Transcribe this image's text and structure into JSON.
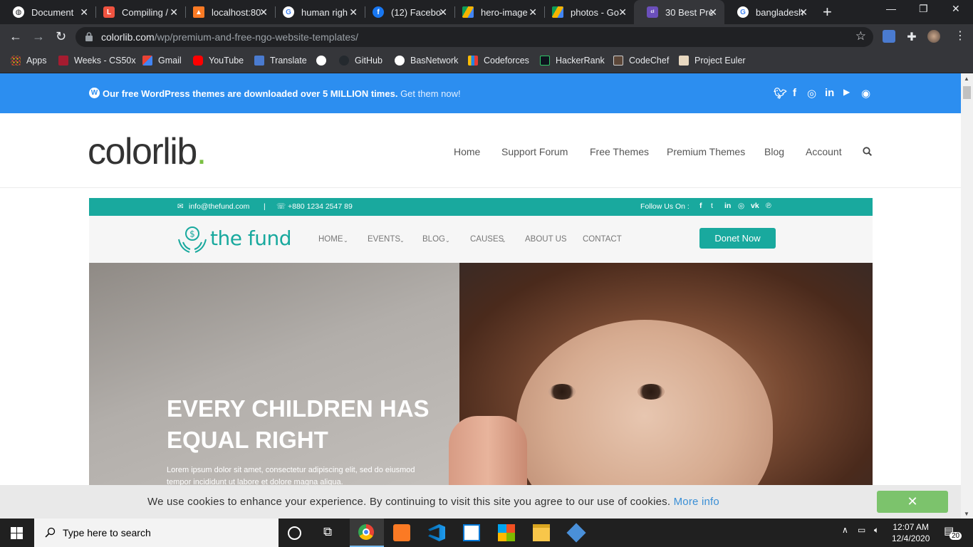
{
  "browser": {
    "tabs": [
      {
        "label": "Document",
        "favicon": "globe-icon"
      },
      {
        "label": "Compiling /",
        "favicon": "laravel-icon"
      },
      {
        "label": "localhost:80",
        "favicon": "xampp-icon"
      },
      {
        "label": "human righ",
        "favicon": "google-icon"
      },
      {
        "label": "(12) Facebo",
        "favicon": "facebook-icon"
      },
      {
        "label": "hero-image",
        "favicon": "drive-icon"
      },
      {
        "label": "photos - Go",
        "favicon": "drive-icon"
      },
      {
        "label": "30 Best Pre",
        "favicon": "colorlib-icon",
        "active": true
      },
      {
        "label": "bangladesh",
        "favicon": "google-icon"
      }
    ],
    "address_bar": {
      "domain": "colorlib.com",
      "path": "/wp/premium-and-free-ngo-website-templates/"
    },
    "bookmarks": [
      {
        "label": "Apps"
      },
      {
        "label": "Weeks - CS50x"
      },
      {
        "label": "Gmail"
      },
      {
        "label": "YouTube"
      },
      {
        "label": "Translate"
      },
      {
        "label": ""
      },
      {
        "label": "GitHub"
      },
      {
        "label": "BasNetwork"
      },
      {
        "label": "Codeforces"
      },
      {
        "label": "HackerRank"
      },
      {
        "label": "CodeChef"
      },
      {
        "label": "Project Euler"
      }
    ]
  },
  "promo": {
    "message": "Our free WordPress themes are downloaded over 5 MILLION times.",
    "cta": "Get them now!"
  },
  "site": {
    "logo": "colorlib",
    "logo_dot": ".",
    "menu": [
      "Home",
      "Support Forum",
      "Free Themes",
      "Premium Themes",
      "Blog",
      "Account"
    ]
  },
  "preview": {
    "email": "info@thefund.com",
    "separator": "|",
    "phone": "+880 1234 2547 89",
    "follow": "Follow Us On :",
    "brand": "the fund",
    "menu": [
      "HOME",
      "EVENTS",
      "BLOG",
      "CAUSES",
      "ABOUT US",
      "CONTACT"
    ],
    "donate_label": "Donet Now",
    "hero_title_1": "EVERY CHILDREN HAS",
    "hero_title_2": "EQUAL RIGHT",
    "hero_text_1": "Lorem ipsum dolor sit amet, consectetur adipiscing elit, sed do eiusmod",
    "hero_text_2": "tempor incididunt ut labore et dolore magna aliqua."
  },
  "cookie": {
    "text": "We use cookies to enhance your experience. By continuing to visit this site you agree to our use of cookies.",
    "more": "More info",
    "close": "✕"
  },
  "taskbar": {
    "search_placeholder": "Type here to search",
    "time": "12:07 AM",
    "date": "12/4/2020",
    "notifications": "20"
  },
  "colors": {
    "accent_blue": "#2c8ef0",
    "fund_teal": "#19a99e",
    "colorlib_green": "#7bc043",
    "cookie_green": "#7cc36c"
  }
}
